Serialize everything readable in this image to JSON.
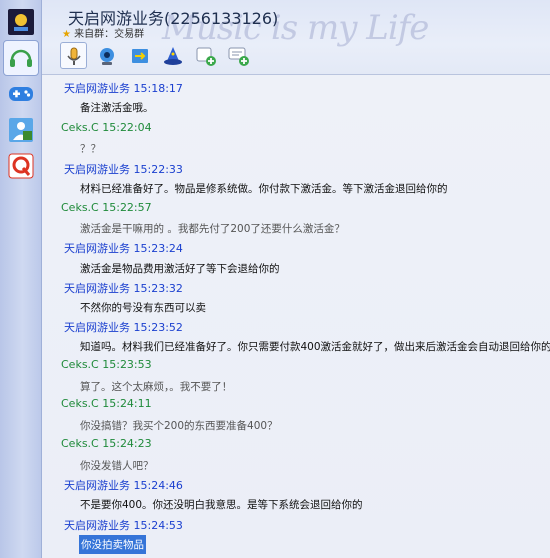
{
  "header": {
    "title": "天启网游业务(2256133126)",
    "source": "来自群：交易群",
    "watermark": "Music is my Life"
  },
  "dock": {
    "items": [
      {
        "name": "qq-logo-icon"
      },
      {
        "name": "headset-icon"
      },
      {
        "name": "gamepad-icon"
      },
      {
        "name": "person-icon"
      },
      {
        "name": "q-brand-icon"
      }
    ]
  },
  "toolbar": {
    "items": [
      "microphone-icon",
      "webcam-icon",
      "file-transfer-icon",
      "wizard-hat-icon",
      "add-member-icon",
      "add-chat-icon"
    ]
  },
  "messages": [
    {
      "sender": "天启网游业务",
      "time": "15:18:17",
      "text": "备注激活金哦。",
      "type": "biz",
      "style": "dark"
    },
    {
      "sender": "Ceks.C",
      "time": "15:22:04",
      "text": "？？",
      "type": "ceks",
      "style": "gray"
    },
    {
      "sender": "天启网游业务",
      "time": "15:22:33",
      "text": "材料已经准备好了。物品是修系统做。你付款下激活金。等下激活金退回给你的",
      "type": "biz",
      "style": "dark"
    },
    {
      "sender": "Ceks.C",
      "time": "15:22:57",
      "text": "激活金是干嘛用的 。我都先付了200了还要什么激活金？",
      "type": "ceks",
      "style": "gray"
    },
    {
      "sender": "天启网游业务",
      "time": "15:23:24",
      "text": "激活金是物品费用激活好了等下会退给你的",
      "type": "biz",
      "style": "dark"
    },
    {
      "sender": "天启网游业务",
      "time": "15:23:32",
      "text": "不然你的号没有东西可以卖",
      "type": "biz",
      "style": "dark"
    },
    {
      "sender": "天启网游业务",
      "time": "15:23:52",
      "text": "知道吗。材料我们已经准备好了。你只需要付款400激活金就好了，做出来后激活金会自动退回给你的",
      "type": "biz",
      "style": "dark"
    },
    {
      "sender": "Ceks.C",
      "time": "15:23:53",
      "text": "算了。这个太麻烦，。我不要了！",
      "type": "ceks",
      "style": "gray"
    },
    {
      "sender": "Ceks.C",
      "time": "15:24:11",
      "text": "你没搞错？我买个200的东西要准备400？",
      "type": "ceks",
      "style": "gray"
    },
    {
      "sender": "Ceks.C",
      "time": "15:24:23",
      "text": "你没发错人吧？",
      "type": "ceks",
      "style": "gray"
    },
    {
      "sender": "天启网游业务",
      "time": "15:24:46",
      "text": "不是要你400。你还没明白我意思。是等下系统会退回给你的",
      "type": "biz",
      "style": "dark"
    },
    {
      "sender": "天启网游业务",
      "time": "15:24:53",
      "text": "你没拍卖物品",
      "type": "biz",
      "style": "sel"
    }
  ]
}
